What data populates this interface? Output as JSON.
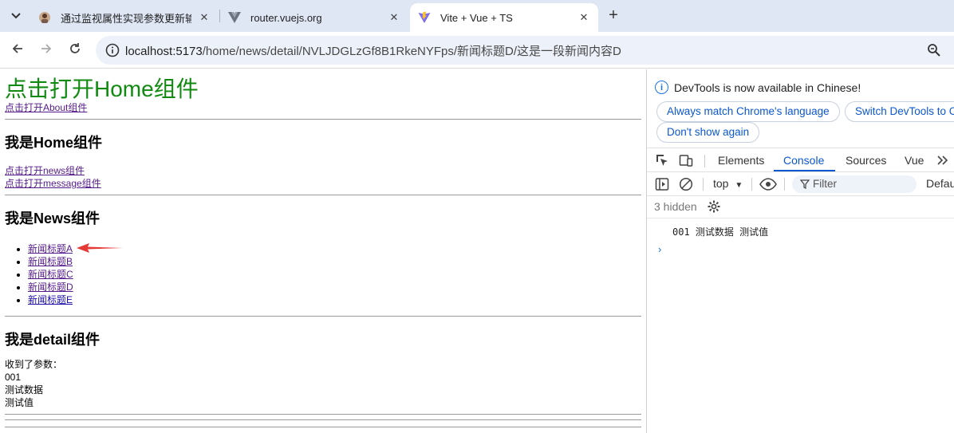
{
  "browser": {
    "tabs": [
      {
        "title": "通过监视属性实现参数更新输出",
        "active": false
      },
      {
        "title": "router.vuejs.org",
        "active": false
      },
      {
        "title": "Vite + Vue + TS",
        "active": true
      }
    ],
    "url_host": "localhost:5173",
    "url_path": "/home/news/detail/NVLJDGLzGf8B1RkeNYFps/新闻标题D/这是一段新闻内容D"
  },
  "page": {
    "home_link": "点击打开Home组件",
    "about_link": "点击打开About组件",
    "home_heading": "我是Home组件",
    "news_link": "点击打开news组件",
    "message_link": "点击打开message组件",
    "news_heading": "我是News组件",
    "news_items": [
      "新闻标题A",
      "新闻标题B",
      "新闻标题C",
      "新闻标题D",
      "新闻标题E"
    ],
    "detail_heading": "我是detail组件",
    "received_label": "收到了参数：",
    "params": [
      "001",
      "测试数据",
      "测试值"
    ]
  },
  "devtools": {
    "info_text": "DevTools is now available in Chinese!",
    "btn_match": "Always match Chrome's language",
    "btn_switch": "Switch DevTools to C",
    "btn_dont_show": "Don't show again",
    "tabs": [
      "Elements",
      "Console",
      "Sources",
      "Vue"
    ],
    "active_tab": "Console",
    "context": "top",
    "filter_placeholder": "Filter",
    "levels": "Defau",
    "hidden_count": "3 hidden",
    "log_line": "001 测试数据 测试值"
  }
}
